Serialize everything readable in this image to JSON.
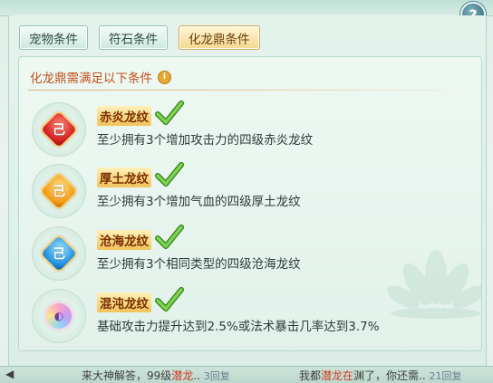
{
  "help": {
    "label": "?"
  },
  "tabs": [
    {
      "label": "宠物条件",
      "active": false
    },
    {
      "label": "符石条件",
      "active": false
    },
    {
      "label": "化龙鼎条件",
      "active": true
    }
  ],
  "panel": {
    "title": "化龙鼎需满足以下条件",
    "info_icon": "i"
  },
  "conditions": [
    {
      "name": "赤炎龙纹",
      "desc": "至少拥有3个增加攻击力的四级赤炎龙纹",
      "gem": "red-dragon-gem",
      "glyph": "己",
      "met": true
    },
    {
      "name": "厚土龙纹",
      "desc": "至少拥有3个增加气血的四级厚土龙纹",
      "gem": "orange-dragon-gem",
      "glyph": "己",
      "met": true
    },
    {
      "name": "沧海龙纹",
      "desc": "至少拥有3个相同类型的四级沧海龙纹",
      "gem": "blue-dragon-gem",
      "glyph": "己",
      "met": true
    },
    {
      "name": "混沌龙纹",
      "desc": "基础攻击力提升达到2.5%或法术暴击几率达到3.7%",
      "gem": "chaos-dragon-gem",
      "glyph": "◐",
      "met": true
    }
  ],
  "chat": {
    "left_a": "来大神解答，99级",
    "left_hl": "潜龙",
    "left_b": "..",
    "left_replies": "3回复",
    "right_a": "我都",
    "right_hl": "潜龙在",
    "right_b": "渊了，你还需..",
    "right_replies": "21回复"
  },
  "colors": {
    "accent_active_tab": "#f3d88f",
    "title": "#c0521a",
    "check": "#4fb52a",
    "highlight": "#d23a1d"
  }
}
